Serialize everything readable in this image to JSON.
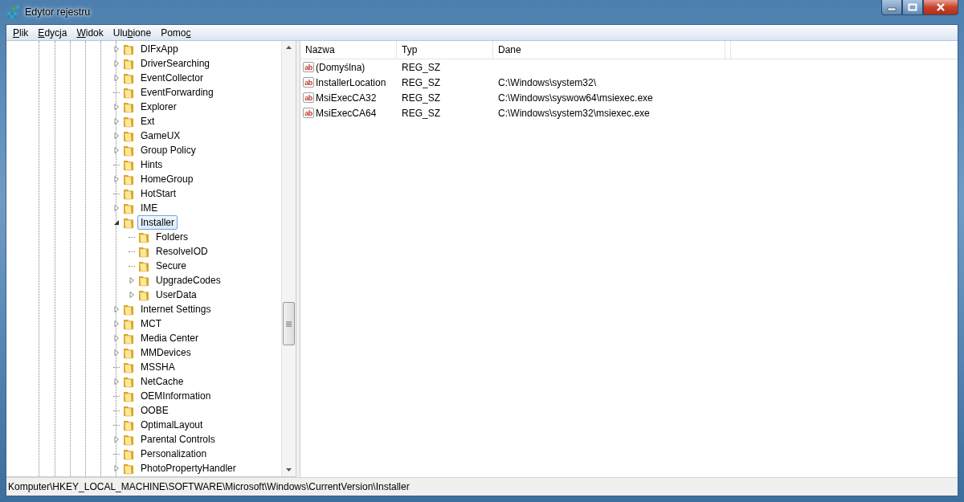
{
  "window": {
    "title": "Edytor rejestru"
  },
  "menu": [
    {
      "key": "P",
      "post": "lik"
    },
    {
      "key": "E",
      "post": "dycja"
    },
    {
      "key": "W",
      "post": "idok"
    },
    {
      "pre": "Ulu",
      "key": "b",
      "post": "ione"
    },
    {
      "pre": "Pomo",
      "key": "c"
    }
  ],
  "tree": {
    "items": [
      {
        "label": "DIFxApp",
        "kind": "branch",
        "expanded": false,
        "selected": false
      },
      {
        "label": "DriverSearching",
        "kind": "branch",
        "expanded": false,
        "selected": false
      },
      {
        "label": "EventCollector",
        "kind": "branch",
        "expanded": false,
        "selected": false
      },
      {
        "label": "EventForwarding",
        "kind": "leaf",
        "selected": false
      },
      {
        "label": "Explorer",
        "kind": "branch",
        "expanded": false,
        "selected": false
      },
      {
        "label": "Ext",
        "kind": "branch",
        "expanded": false,
        "selected": false
      },
      {
        "label": "GameUX",
        "kind": "branch",
        "expanded": false,
        "selected": false
      },
      {
        "label": "Group Policy",
        "kind": "branch",
        "expanded": false,
        "selected": false
      },
      {
        "label": "Hints",
        "kind": "leaf",
        "selected": false
      },
      {
        "label": "HomeGroup",
        "kind": "branch",
        "expanded": false,
        "selected": false
      },
      {
        "label": "HotStart",
        "kind": "leaf",
        "selected": false
      },
      {
        "label": "IME",
        "kind": "branch",
        "expanded": false,
        "selected": false
      },
      {
        "label": "Installer",
        "kind": "branch",
        "expanded": true,
        "selected": true,
        "children": [
          {
            "label": "Folders",
            "kind": "leaf",
            "selected": false
          },
          {
            "label": "ResolveIOD",
            "kind": "leaf",
            "selected": false
          },
          {
            "label": "Secure",
            "kind": "leaf",
            "selected": false
          },
          {
            "label": "UpgradeCodes",
            "kind": "branch",
            "expanded": false,
            "selected": false
          },
          {
            "label": "UserData",
            "kind": "branch",
            "expanded": false,
            "selected": false
          }
        ]
      },
      {
        "label": "Internet Settings",
        "kind": "branch",
        "expanded": false,
        "selected": false
      },
      {
        "label": "MCT",
        "kind": "branch",
        "expanded": false,
        "selected": false
      },
      {
        "label": "Media Center",
        "kind": "branch",
        "expanded": false,
        "selected": false
      },
      {
        "label": "MMDevices",
        "kind": "branch",
        "expanded": false,
        "selected": false
      },
      {
        "label": "MSSHA",
        "kind": "leaf",
        "selected": false
      },
      {
        "label": "NetCache",
        "kind": "branch",
        "expanded": false,
        "selected": false
      },
      {
        "label": "OEMInformation",
        "kind": "leaf",
        "selected": false
      },
      {
        "label": "OOBE",
        "kind": "leaf",
        "selected": false
      },
      {
        "label": "OptimalLayout",
        "kind": "leaf",
        "selected": false
      },
      {
        "label": "Parental Controls",
        "kind": "branch",
        "expanded": false,
        "selected": false
      },
      {
        "label": "Personalization",
        "kind": "leaf",
        "selected": false
      },
      {
        "label": "PhotoPropertyHandler",
        "kind": "branch",
        "expanded": false,
        "selected": false
      }
    ]
  },
  "table": {
    "columns": [
      "Nazwa",
      "Typ",
      "Dane"
    ],
    "rows": [
      {
        "icon": "ab",
        "name": "(Domyślna)",
        "type": "REG_SZ"
      },
      {
        "icon": "ab",
        "name": "InstallerLocation",
        "type": "REG_SZ",
        "data": "C:\\Windows\\system32\\"
      },
      {
        "icon": "ab",
        "name": "MsiExecCA32",
        "type": "REG_SZ",
        "data": "C:\\Windows\\syswow64\\msiexec.exe"
      },
      {
        "icon": "ab",
        "name": "MsiExecCA64",
        "type": "REG_SZ",
        "data": "C:\\Windows\\system32\\msiexec.exe"
      }
    ]
  },
  "status_bar": "Komputer\\HKEY_LOCAL_MACHINE\\SOFTWARE\\Microsoft\\Windows\\CurrentVersion\\Installer"
}
